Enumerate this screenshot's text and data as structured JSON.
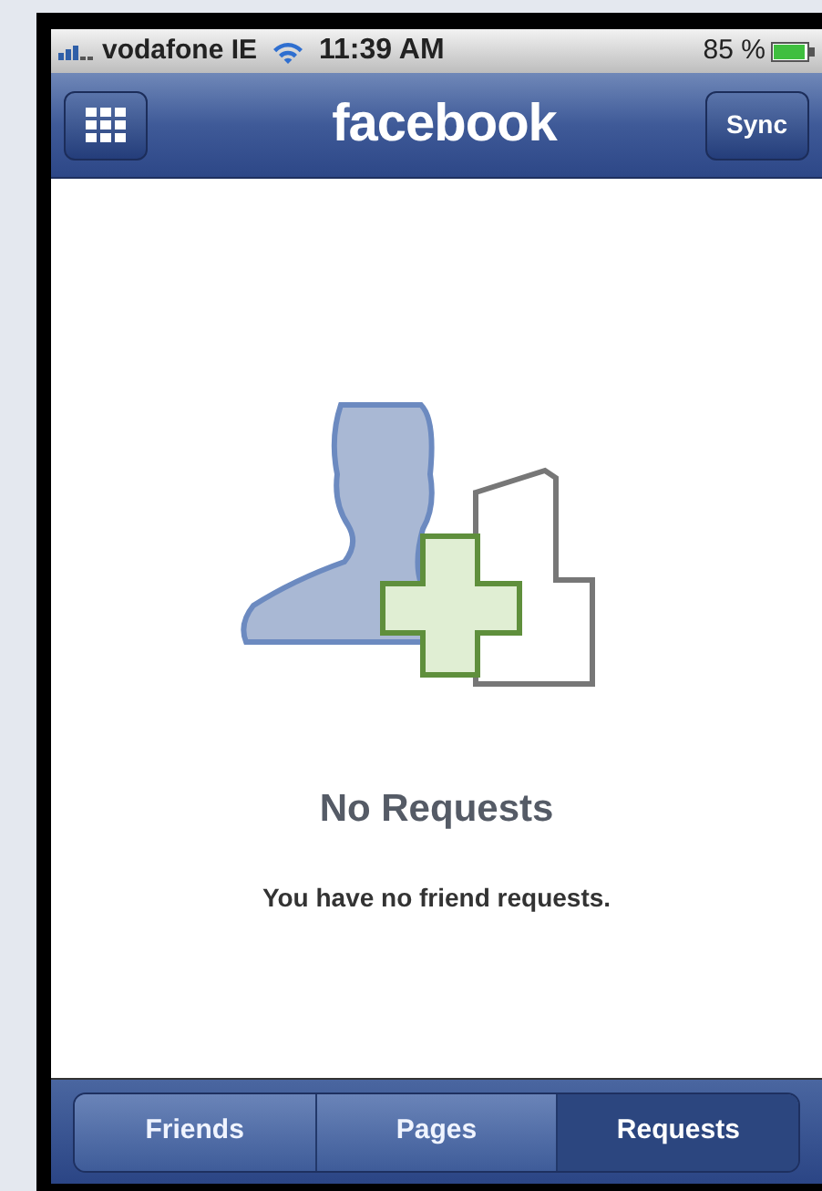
{
  "status_bar": {
    "carrier": "vodafone IE",
    "time": "11:39 AM",
    "battery": "85 %"
  },
  "nav_bar": {
    "title": "facebook",
    "right_button": "Sync"
  },
  "empty_state": {
    "title": "No Requests",
    "message": "You have no friend requests."
  },
  "tabs": [
    {
      "label": "Friends",
      "selected": false
    },
    {
      "label": "Pages",
      "selected": false
    },
    {
      "label": "Requests",
      "selected": true
    }
  ]
}
